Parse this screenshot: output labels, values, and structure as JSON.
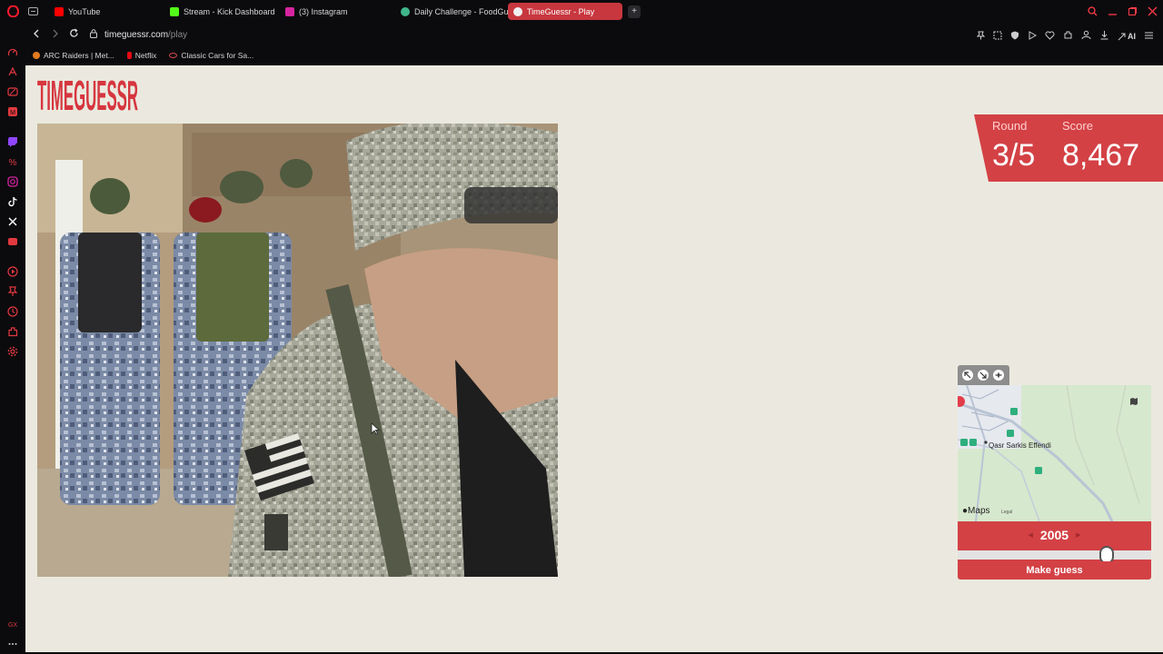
{
  "browser": {
    "tabs": [
      {
        "label": "YouTube",
        "color": "#ff0000"
      },
      {
        "label": "Stream - Kick Dashboard",
        "color": "#53fc18"
      },
      {
        "label": "(3) Instagram",
        "color": "#d6249f"
      },
      {
        "label": "Daily Challenge - FoodGue",
        "color": "#3fb68b"
      },
      {
        "label": "TimeGuessr - Play",
        "color": "#f0f0f0"
      }
    ],
    "url_host": "timeguessr.com",
    "url_path": "/play",
    "ai_label": "AI",
    "bookmarks": [
      {
        "label": "ARC Raiders | Met...",
        "color": "#e07b1f"
      },
      {
        "label": "Netflix",
        "color": "#e50914"
      },
      {
        "label": "Classic Cars for Sa...",
        "color": "#d94b4b"
      }
    ],
    "accent": "#c8373e"
  },
  "game": {
    "logo": "TIMEGUESSR",
    "round_label": "Round",
    "round_value": "3/5",
    "score_label": "Score",
    "score_value": "8,467",
    "map": {
      "place_label": "Qasr Sarkis Effendi",
      "road_badges": [
        "27",
        "28",
        "29",
        "29",
        "27"
      ],
      "brand": "Maps",
      "legal": "Legal"
    },
    "year": "2005",
    "slider_fraction": 0.8,
    "guess_label": "Make guess",
    "colors": {
      "panel_red": "#d34145",
      "page_bg": "#ebe9df"
    }
  }
}
